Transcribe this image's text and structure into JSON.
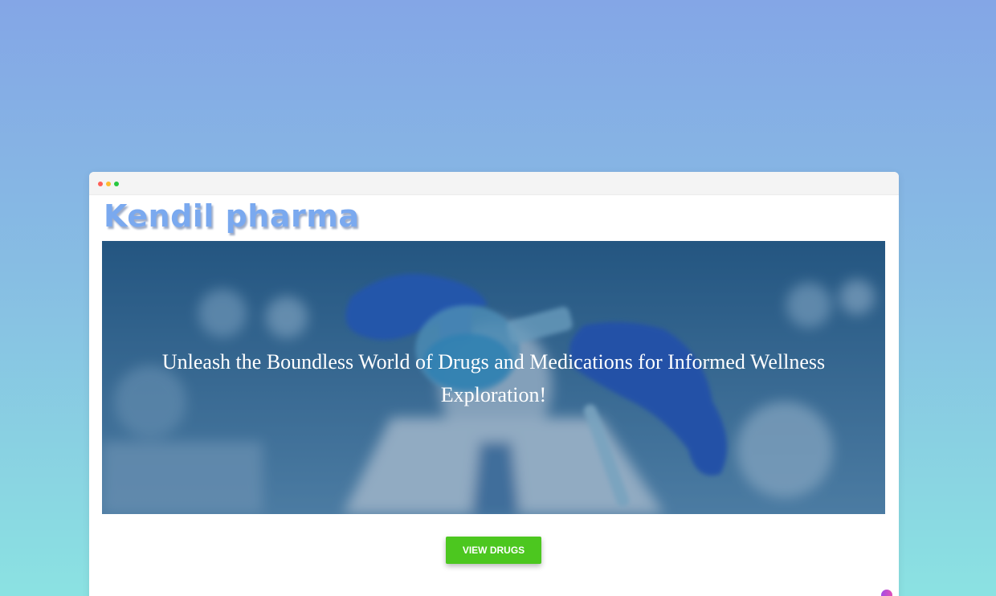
{
  "brand": {
    "logo_text": "Kendil pharma"
  },
  "hero": {
    "headline": "Unleash the Boundless World of Drugs and Medications for Informed Wellness Exploration!",
    "image_description_icon": "scientist-with-flask-icon"
  },
  "cta": {
    "label": "VIEW DRUGS"
  },
  "colors": {
    "logo": "#7aa9ef",
    "cta_button": "#4cc71f",
    "hero_overlay": "#124678"
  }
}
